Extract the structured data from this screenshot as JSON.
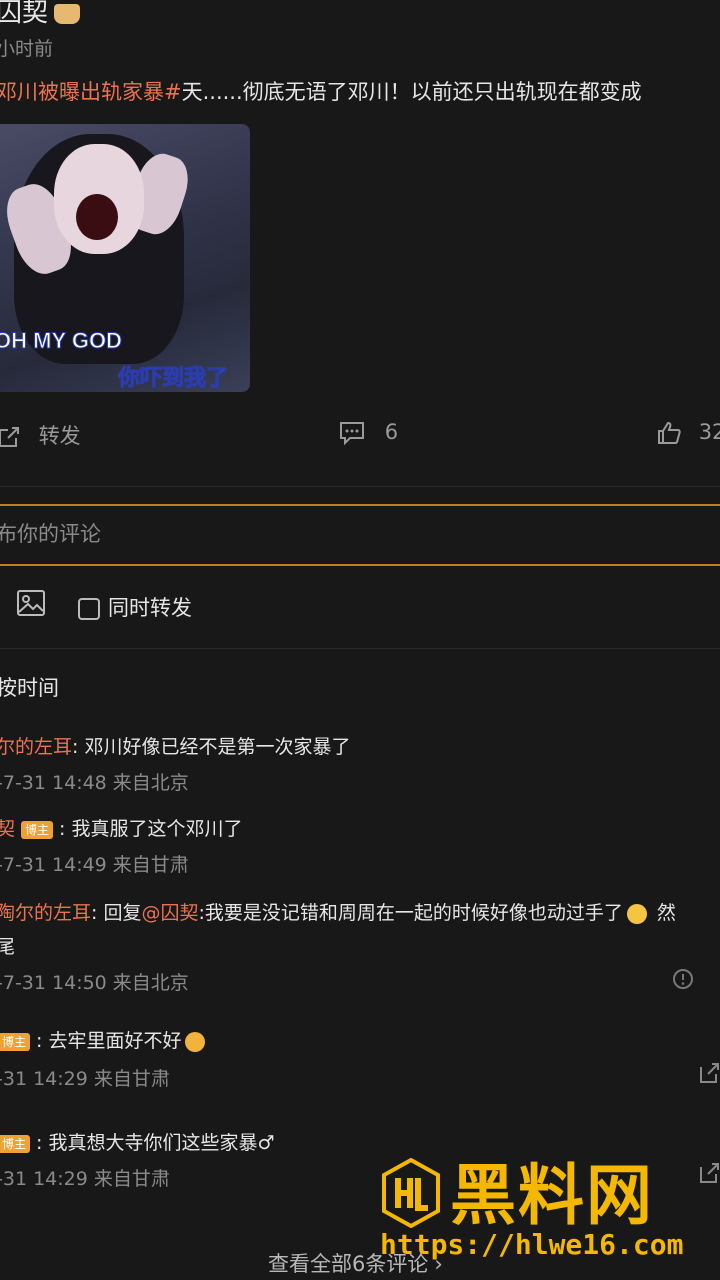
{
  "post": {
    "author_fragment": "囚契",
    "time": "小时前",
    "hashtag": "邓川被曝出轨家暴#",
    "body": "天......彻底无语了邓川！以前还只出轨现在都变成",
    "image_caption_en": "OH MY GOD",
    "image_caption_cn": "你吓到我了",
    "repost_label": "转发",
    "comment_count": "6",
    "like_count": "32"
  },
  "composer": {
    "placeholder": "布你的评论",
    "sync_repost_label": "同时转发"
  },
  "sort_label": "按时间",
  "comments": [
    {
      "user": "尔的左耳",
      "sep": ":",
      "text": " 邓川好像已经不是第一次家暴了",
      "meta": "-7-31 14:48 来自北京"
    },
    {
      "user": "契",
      "badge": "博主",
      "text": ": 我真服了这个邓川了",
      "meta": "-7-31 14:49 来自甘肃"
    },
    {
      "user": "陶尔的左耳",
      "reply_prefix": ": 回复",
      "reply_to": "@囚契",
      "text": ":我要是没记错和周周在一起的时候好像也动过手了",
      "tail": "然",
      "line2": "尾",
      "meta": "-7-31 14:50 来自北京"
    },
    {
      "badge": "博主",
      "text": ": 去牢里面好不好",
      "meta": "-31 14:29 来自甘肃"
    },
    {
      "badge": "博主",
      "text": ": 我真想大寺你们这些家暴♂",
      "meta": "-31 14:29 来自甘肃"
    }
  ],
  "view_all": "查看全部6条评论",
  "watermark": {
    "brand": "黑料网",
    "url": "https://hlwe16.com"
  }
}
